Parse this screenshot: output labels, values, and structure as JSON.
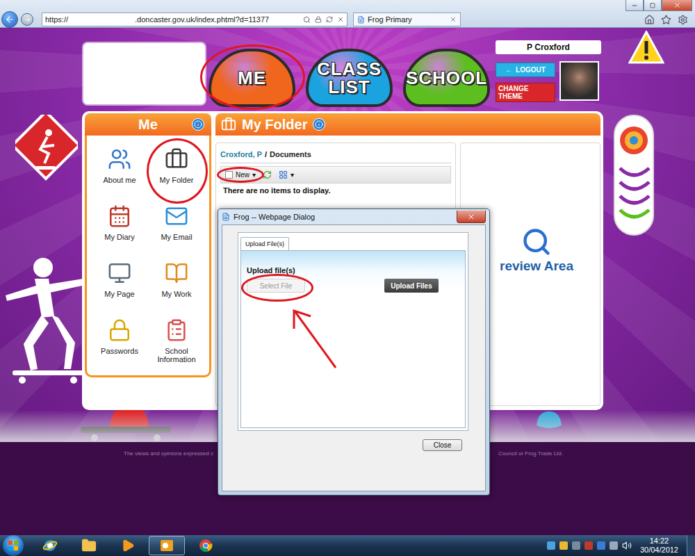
{
  "browser": {
    "address_scheme": "https://",
    "address_rest": ".doncaster.gov.uk/index.phtml?d=11377",
    "tab": "Frog Primary"
  },
  "header": {
    "nav": [
      {
        "label": "ME",
        "color": "#f0661c",
        "circled": true
      },
      {
        "label": "CLASS LIST",
        "color": "#1ba3e0",
        "circled": false
      },
      {
        "label": "SCHOOL",
        "color": "#5dbf1f",
        "circled": false
      }
    ],
    "user": "P Croxford",
    "logout": {
      "icon": "←",
      "label": "LOGOUT"
    },
    "change_theme": "CHANGE THEME"
  },
  "me_panel": {
    "title": "Me",
    "items": [
      {
        "label": "About me",
        "circled": false
      },
      {
        "label": "My Folder",
        "circled": true
      },
      {
        "label": "My Diary",
        "circled": false
      },
      {
        "label": "My Email",
        "circled": false
      },
      {
        "label": "My Page",
        "circled": false
      },
      {
        "label": "My Work",
        "circled": false
      },
      {
        "label": "Passwords",
        "circled": false
      },
      {
        "label": "School Information",
        "circled": false
      }
    ]
  },
  "folder": {
    "title": "My Folder",
    "breadcrumb": [
      {
        "label": "Croxford, P",
        "link": true
      },
      {
        "label": "Documents",
        "link": false
      }
    ],
    "separator": "/",
    "toolbar": {
      "new": {
        "label": "New",
        "caret": "▾",
        "circled": true
      },
      "view_caret": "▾"
    },
    "empty": "There are no items to display.",
    "preview": "review Area"
  },
  "dialog": {
    "title": "Frog -- Webpage Dialog",
    "tabs": [
      {
        "label": "Upload File(s)",
        "selected": true
      }
    ],
    "heading": "Upload file(s)",
    "select": {
      "label": "Select File",
      "disabled": true,
      "circled": true,
      "arrow": true
    },
    "upload": "Upload Files",
    "close": "Close"
  },
  "footer": {
    "left": "The views and opinions expressed c",
    "right": "Council or Frog Trade Ltd."
  },
  "taskbar": {
    "time": "14:22",
    "date": "30/04/2012"
  }
}
